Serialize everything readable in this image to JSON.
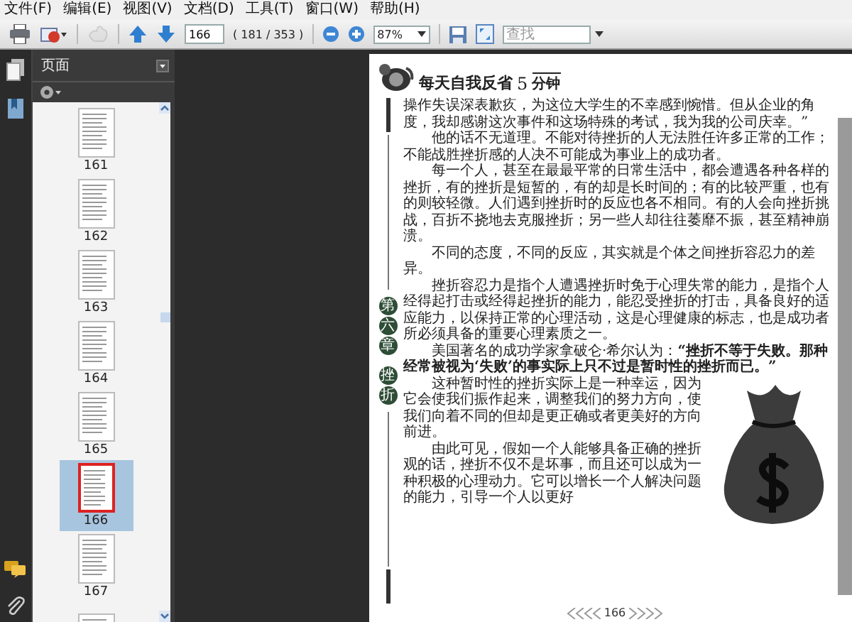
{
  "menu": [
    "文件(F)",
    "编辑(E)",
    "视图(V)",
    "文档(D)",
    "工具(T)",
    "窗口(W)",
    "帮助(H)"
  ],
  "toolbar": [
    {
      "kind": "print",
      "disabled": false
    },
    {
      "kind": "email",
      "disabled": false
    },
    {
      "kind": "hand",
      "disabled": true
    },
    {
      "kind": "prev",
      "disabled": false
    },
    {
      "kind": "next",
      "disabled": false
    },
    {
      "kind": "page_input",
      "value": "166"
    },
    {
      "kind": "page_count",
      "text": "( 181 / 353 )"
    },
    {
      "kind": "zoom_out",
      "disabled": false
    },
    {
      "kind": "zoom_in",
      "disabled": false
    },
    {
      "kind": "zoom_field",
      "value": "87%"
    },
    {
      "kind": "save",
      "disabled": false
    },
    {
      "kind": "fit",
      "disabled": false
    },
    {
      "kind": "search",
      "placeholder": "查找"
    }
  ],
  "sidebar": {
    "panel_title": "页面",
    "thumbnails": [
      {
        "label": "161",
        "selected": false
      },
      {
        "label": "162",
        "selected": false
      },
      {
        "label": "163",
        "selected": false
      },
      {
        "label": "164",
        "selected": false
      },
      {
        "label": "165",
        "selected": false
      },
      {
        "label": "166",
        "selected": true
      },
      {
        "label": "167",
        "selected": false
      },
      {
        "selected": false
      }
    ]
  },
  "page": {
    "header": {
      "title": "每天自我反省",
      "number": "5",
      "unit": "分钟"
    },
    "chapter": [
      "第六章",
      "挫折"
    ],
    "paragraphs": [
      "操作失误深表歉疚，为这位大学生的不幸感到惋惜。但从企业的角度，我却感谢这次事件和这场特殊的考试，我为我的公司庆幸。”",
      "他的话不无道理。不能对待挫折的人无法胜任许多正常的工作；不能战胜挫折感的人决不可能成为事业上的成功者。",
      "每一个人，甚至在最最平常的日常生活中，都会遭遇各种各样的挫折，有的挫折是短暂的，有的却是长时间的；有的比较严重，也有的则较轻微。人们遇到挫折时的反应也各不相同。有的人会向挫折挑战，百折不挠地去克服挫折；另一些人却往往萎靡不振，甚至精神崩溃。",
      "不同的态度，不同的反应，其实就是个体之间挫折容忍力的差异。",
      "挫折容忍力是指个人遭遇挫折时免于心理失常的能力，是指个人经得起打击或经得起挫折的能力，能忍受挫折的打击，具备良好的适应能力，以保持正常的心理活动，这是心理健康的标志，也是成功者所必须具备的重要心理素质之一。",
      "美国著名的成功学家拿破仑·希尔认为：**“挫折不等于失败。那种经常被视为‘失败’的事实际上只不过是暂时性的挫折而已。”**",
      "这种暂时性的挫折实际上是一种幸运，因为它会使我们振作起来，调整我们的努力方向，使我们向着不同的但却是更正确或者更美好的方向前进。",
      "由此可见，假如一个人能够具备正确的挫折观的话，挫折不仅不是坏事，而且还可以成为一种积极的心理动力。它可以增长一个人解决问题的能力，引导一个人以更好"
    ],
    "page_number": "166"
  }
}
